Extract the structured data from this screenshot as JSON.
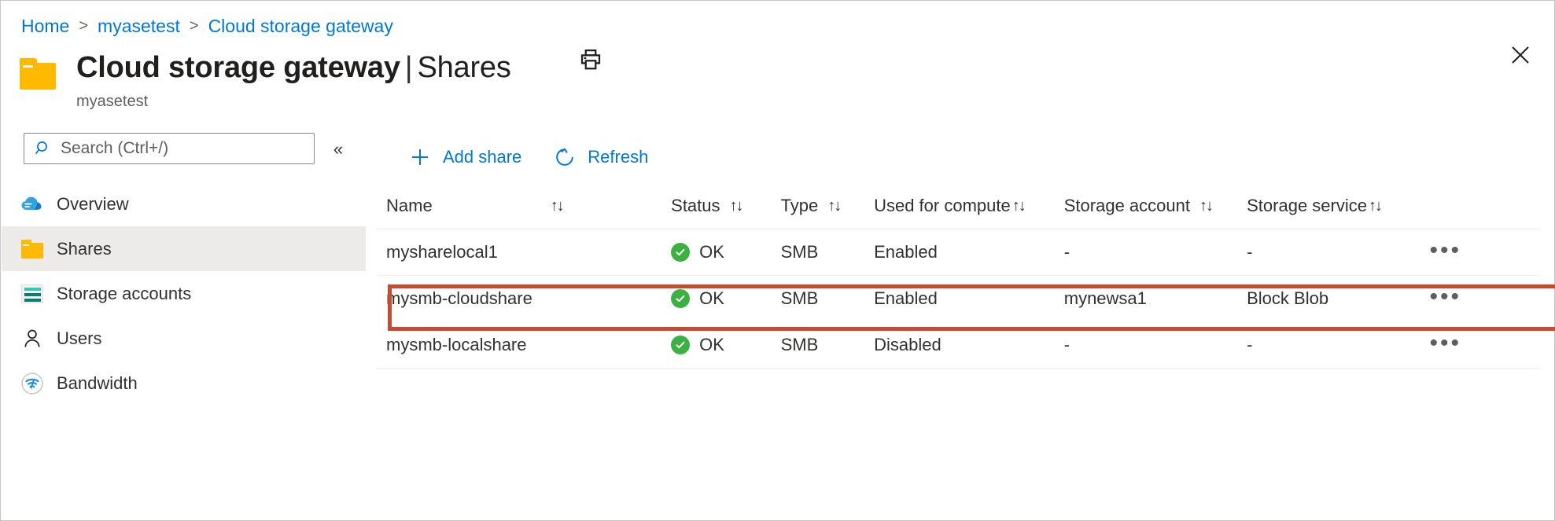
{
  "breadcrumb": {
    "items": [
      {
        "label": "Home"
      },
      {
        "label": "myasetest"
      },
      {
        "label": "Cloud storage gateway"
      }
    ],
    "separator": ">"
  },
  "header": {
    "title": "Cloud storage gateway",
    "title_separator": "|",
    "title_sub": "Shares",
    "subtitle": "myasetest",
    "print_icon": "print-icon",
    "close_icon": "close-icon",
    "folder_icon": "folder-icon"
  },
  "search": {
    "placeholder": "Search (Ctrl+/)",
    "value": "",
    "icon": "search-icon",
    "collapse_label": "«"
  },
  "sidebar": {
    "items": [
      {
        "label": "Overview",
        "icon": "cloud-icon",
        "selected": false
      },
      {
        "label": "Shares",
        "icon": "folder-icon",
        "selected": true
      },
      {
        "label": "Storage accounts",
        "icon": "storage-accounts-icon",
        "selected": false
      },
      {
        "label": "Users",
        "icon": "user-icon",
        "selected": false
      },
      {
        "label": "Bandwidth",
        "icon": "bandwidth-icon",
        "selected": false
      }
    ]
  },
  "toolbar": {
    "add_share_label": "Add share",
    "add_share_icon": "plus-icon",
    "refresh_label": "Refresh",
    "refresh_icon": "refresh-icon"
  },
  "table": {
    "columns": [
      {
        "label": "Name",
        "sort": "↑↓"
      },
      {
        "label": "Status",
        "sort": "↑↓"
      },
      {
        "label": "Type",
        "sort": "↑↓"
      },
      {
        "label": "Used for compute",
        "sort": "↑↓"
      },
      {
        "label": "Storage account",
        "sort": "↑↓"
      },
      {
        "label": "Storage service",
        "sort": "↑↓"
      }
    ],
    "rows": [
      {
        "name": "mysharelocal1",
        "status": "OK",
        "type": "SMB",
        "used_for_compute": "Enabled",
        "storage_account": "-",
        "storage_service": "-",
        "more": "•••",
        "highlighted": false
      },
      {
        "name": "mysmb-cloudshare",
        "status": "OK",
        "type": "SMB",
        "used_for_compute": "Enabled",
        "storage_account": "mynewsa1",
        "storage_service": "Block Blob",
        "more": "•••",
        "highlighted": true
      },
      {
        "name": "mysmb-localshare",
        "status": "OK",
        "type": "SMB",
        "used_for_compute": "Disabled",
        "storage_account": "-",
        "storage_service": "-",
        "more": "•••",
        "highlighted": false
      }
    ]
  },
  "colors": {
    "link": "#0078d4",
    "status_ok": "#3bb143",
    "highlight_border": "#c84b31",
    "folder_yellow": "#ffb900",
    "selected_row_bg": "#edebe9"
  }
}
